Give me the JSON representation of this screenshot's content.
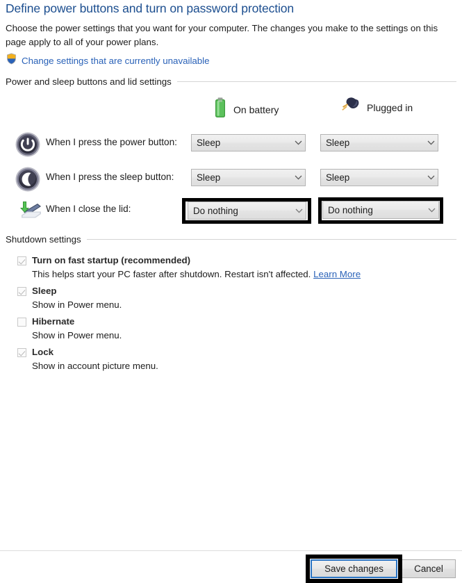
{
  "page": {
    "title": "Define power buttons and turn on password protection",
    "intro": "Choose the power settings that you want for your computer. The changes you make to the settings on this page apply to all of your power plans.",
    "uac_link": "Change settings that are currently unavailable",
    "uac_icon": "shield-icon"
  },
  "groups": {
    "power_sleep_lid": "Power and sleep buttons and lid settings",
    "shutdown": "Shutdown settings"
  },
  "columns": [
    {
      "label": "On battery",
      "icon": "battery-icon"
    },
    {
      "label": "Plugged in",
      "icon": "power-plug-icon"
    }
  ],
  "rows": [
    {
      "label": "When I press the power button:",
      "icon": "power-button-icon",
      "on_battery": "Sleep",
      "plugged_in": "Sleep",
      "highlighted": false
    },
    {
      "label": "When I press the sleep button:",
      "icon": "sleep-moon-icon",
      "on_battery": "Sleep",
      "plugged_in": "Sleep",
      "highlighted": false
    },
    {
      "label": "When I close the lid:",
      "icon": "laptop-lid-icon",
      "on_battery": "Do nothing",
      "plugged_in": "Do nothing",
      "highlighted": true
    }
  ],
  "shutdown_options": [
    {
      "title": "Turn on fast startup (recommended)",
      "checked": true,
      "description": "This helps start your PC faster after shutdown. Restart isn't affected.",
      "link": "Learn More"
    },
    {
      "title": "Sleep",
      "checked": true,
      "description": "Show in Power menu.",
      "link": ""
    },
    {
      "title": "Hibernate",
      "checked": false,
      "description": "Show in Power menu.",
      "link": ""
    },
    {
      "title": "Lock",
      "checked": true,
      "description": "Show in account picture menu.",
      "link": ""
    }
  ],
  "footer": {
    "save_label": "Save changes",
    "cancel_label": "Cancel"
  },
  "colors": {
    "title_blue": "#1c4e8f",
    "link_blue": "#2a62b8",
    "highlight_black": "#000000",
    "focus_blue": "#2a74c4",
    "battery_green": "#4eb24e"
  }
}
